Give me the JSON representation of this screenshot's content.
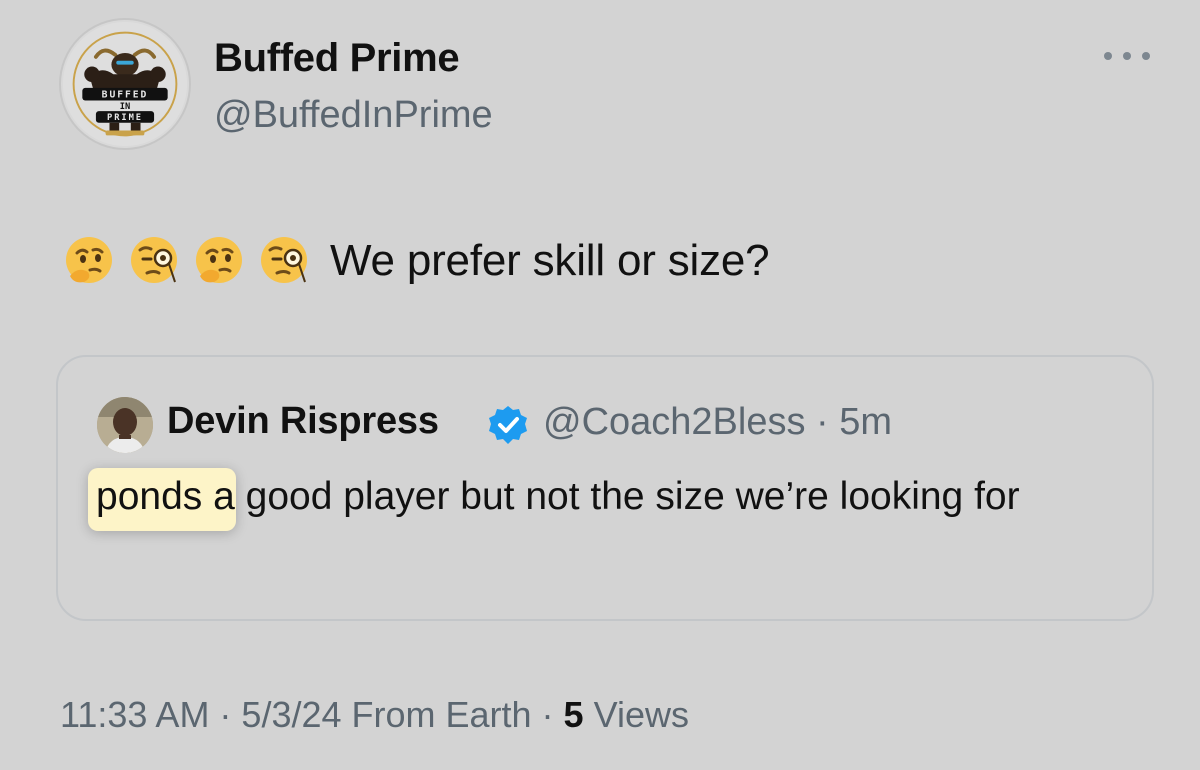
{
  "tweet": {
    "author": {
      "name": "Buffed Prime",
      "handle": "@BuffedInPrime",
      "avatar_text_top": "BUFFED",
      "avatar_text_mid": "IN",
      "avatar_text_bottom": "PRIME"
    },
    "emojis": [
      "thinking-face",
      "face-with-monocle",
      "thinking-face",
      "face-with-monocle"
    ],
    "text": "We prefer skill or size?",
    "quote": {
      "name": "Devin Rispress",
      "handle": "@Coach2Bless",
      "time": "5m",
      "meta": "@Coach2Bless · 5m",
      "highlighted_word": "ponds",
      "body_rest": " a good player but not the size we’re looking for"
    },
    "footer": {
      "time_date_source": "11:33 AM · 5/3/24 From Earth · ",
      "views_count": "5",
      "views_label": " Views"
    }
  },
  "colors": {
    "background": "#d3d3d3",
    "text": "#111111",
    "muted": "#5b6670",
    "verified": "#1d9bf0",
    "highlight": "#fdf4c8"
  }
}
